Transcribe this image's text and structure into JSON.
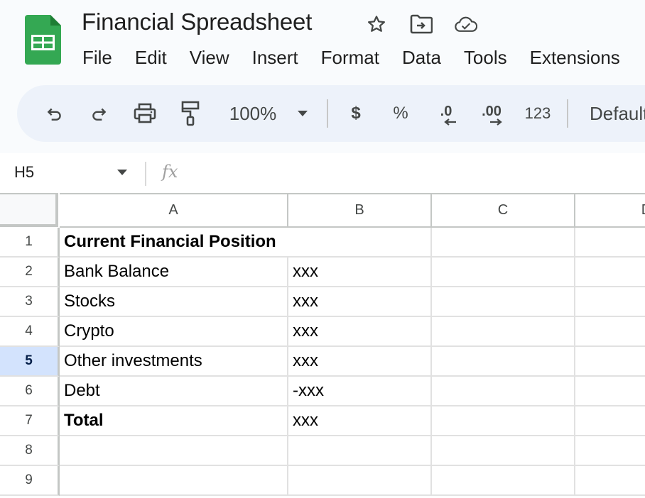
{
  "app": {
    "title": "Financial Spreadsheet",
    "brand_color": "#34a853",
    "title_icons": [
      "star-icon",
      "move-to-folder-icon",
      "cloud-saved-icon"
    ]
  },
  "menu": [
    "File",
    "Edit",
    "View",
    "Insert",
    "Format",
    "Data",
    "Tools",
    "Extensions"
  ],
  "toolbar": {
    "zoom": "100%",
    "currency": "$",
    "percent": "%",
    "decrease_decimal": ".0",
    "increase_decimal": ".00",
    "number_format": "123",
    "font": "Default"
  },
  "formula_bar": {
    "name_box": "H5",
    "fx_label": "fx",
    "formula": ""
  },
  "grid": {
    "columns": [
      "A",
      "B",
      "C",
      "D"
    ],
    "selected_row": "5",
    "rows": [
      {
        "num": "1",
        "a": "Current Financial Position",
        "b": "",
        "bold": true
      },
      {
        "num": "2",
        "a": "Bank Balance",
        "b": "xxx",
        "bold": false
      },
      {
        "num": "3",
        "a": "Stocks",
        "b": "xxx",
        "bold": false
      },
      {
        "num": "4",
        "a": "Crypto",
        "b": "xxx",
        "bold": false
      },
      {
        "num": "5",
        "a": "Other investments",
        "b": "xxx",
        "bold": false
      },
      {
        "num": "6",
        "a": "Debt",
        "b": "-xxx",
        "bold": false
      },
      {
        "num": "7",
        "a": "Total",
        "b": "xxx",
        "bold": true
      },
      {
        "num": "8",
        "a": "",
        "b": "",
        "bold": false
      },
      {
        "num": "9",
        "a": "",
        "b": "",
        "bold": false
      }
    ]
  }
}
